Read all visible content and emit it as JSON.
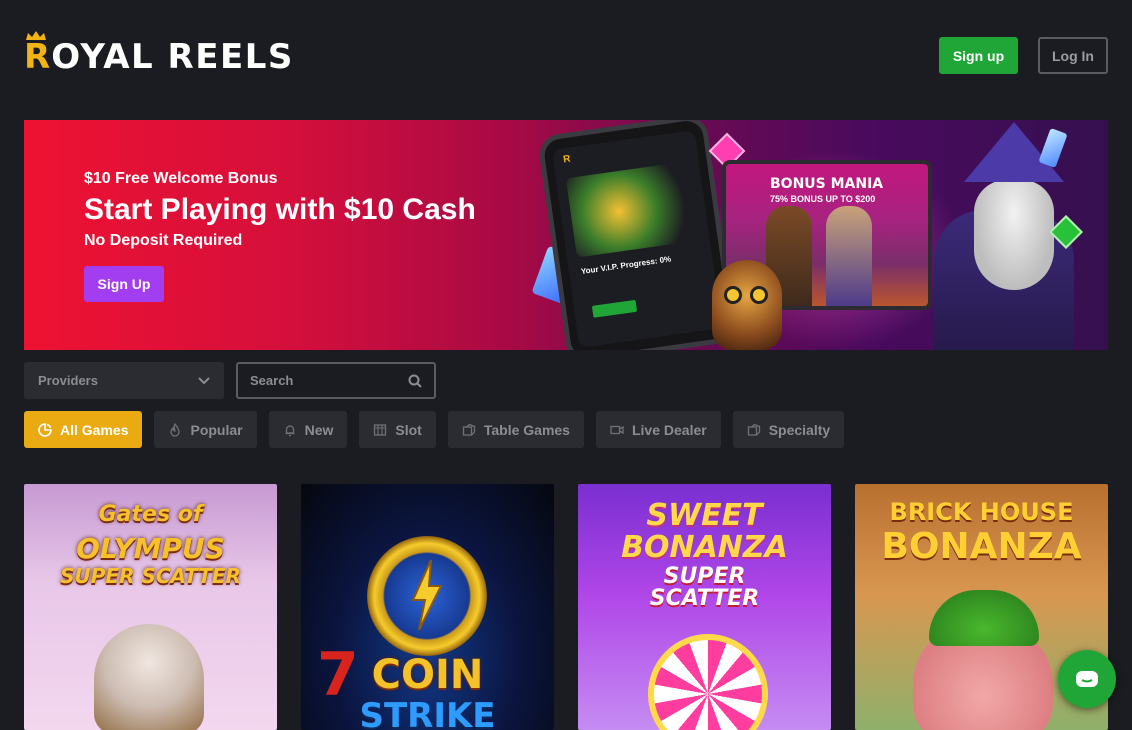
{
  "header": {
    "logo_first": "R",
    "logo_rest": "OYAL REELS",
    "signup_label": "Sign up",
    "login_label": "Log In"
  },
  "banner": {
    "subtitle": "$10 Free Welcome Bonus",
    "title": "Start Playing with $10 Cash",
    "note": "No Deposit Required",
    "button_label": "Sign Up",
    "promo_title": "BONUS MANIA",
    "promo_sub": "75% BONUS UP TO $200",
    "phone_text": "Your V.I.P. Progress: 0%"
  },
  "filters": {
    "providers_label": "Providers",
    "search_placeholder": "Search"
  },
  "categories": [
    {
      "label": "All Games",
      "icon": "all-games-icon",
      "active": true
    },
    {
      "label": "Popular",
      "icon": "flame-icon",
      "active": false
    },
    {
      "label": "New",
      "icon": "bell-icon",
      "active": false
    },
    {
      "label": "Slot",
      "icon": "slot-machine-icon",
      "active": false
    },
    {
      "label": "Table Games",
      "icon": "dice-icon",
      "active": false
    },
    {
      "label": "Live Dealer",
      "icon": "video-icon",
      "active": false
    },
    {
      "label": "Specialty",
      "icon": "dice-icon",
      "active": false
    }
  ],
  "games": [
    {
      "title_lines": [
        "Gates of",
        "OLYMPUS",
        "SUPER SCATTER"
      ]
    },
    {
      "title_lines": [
        "COIN",
        "STRIKE"
      ]
    },
    {
      "title_lines": [
        "SWEET",
        "BONANZA",
        "SUPER",
        "SCATTER"
      ]
    },
    {
      "title_lines": [
        "BRICK HOUSE",
        "BONANZA"
      ]
    }
  ],
  "colors": {
    "background": "#1b1c21",
    "brand_gold": "#f2b415",
    "signup_green": "#1fa637",
    "active_category": "#e9aa12",
    "banner_cta": "#a23ef0"
  }
}
